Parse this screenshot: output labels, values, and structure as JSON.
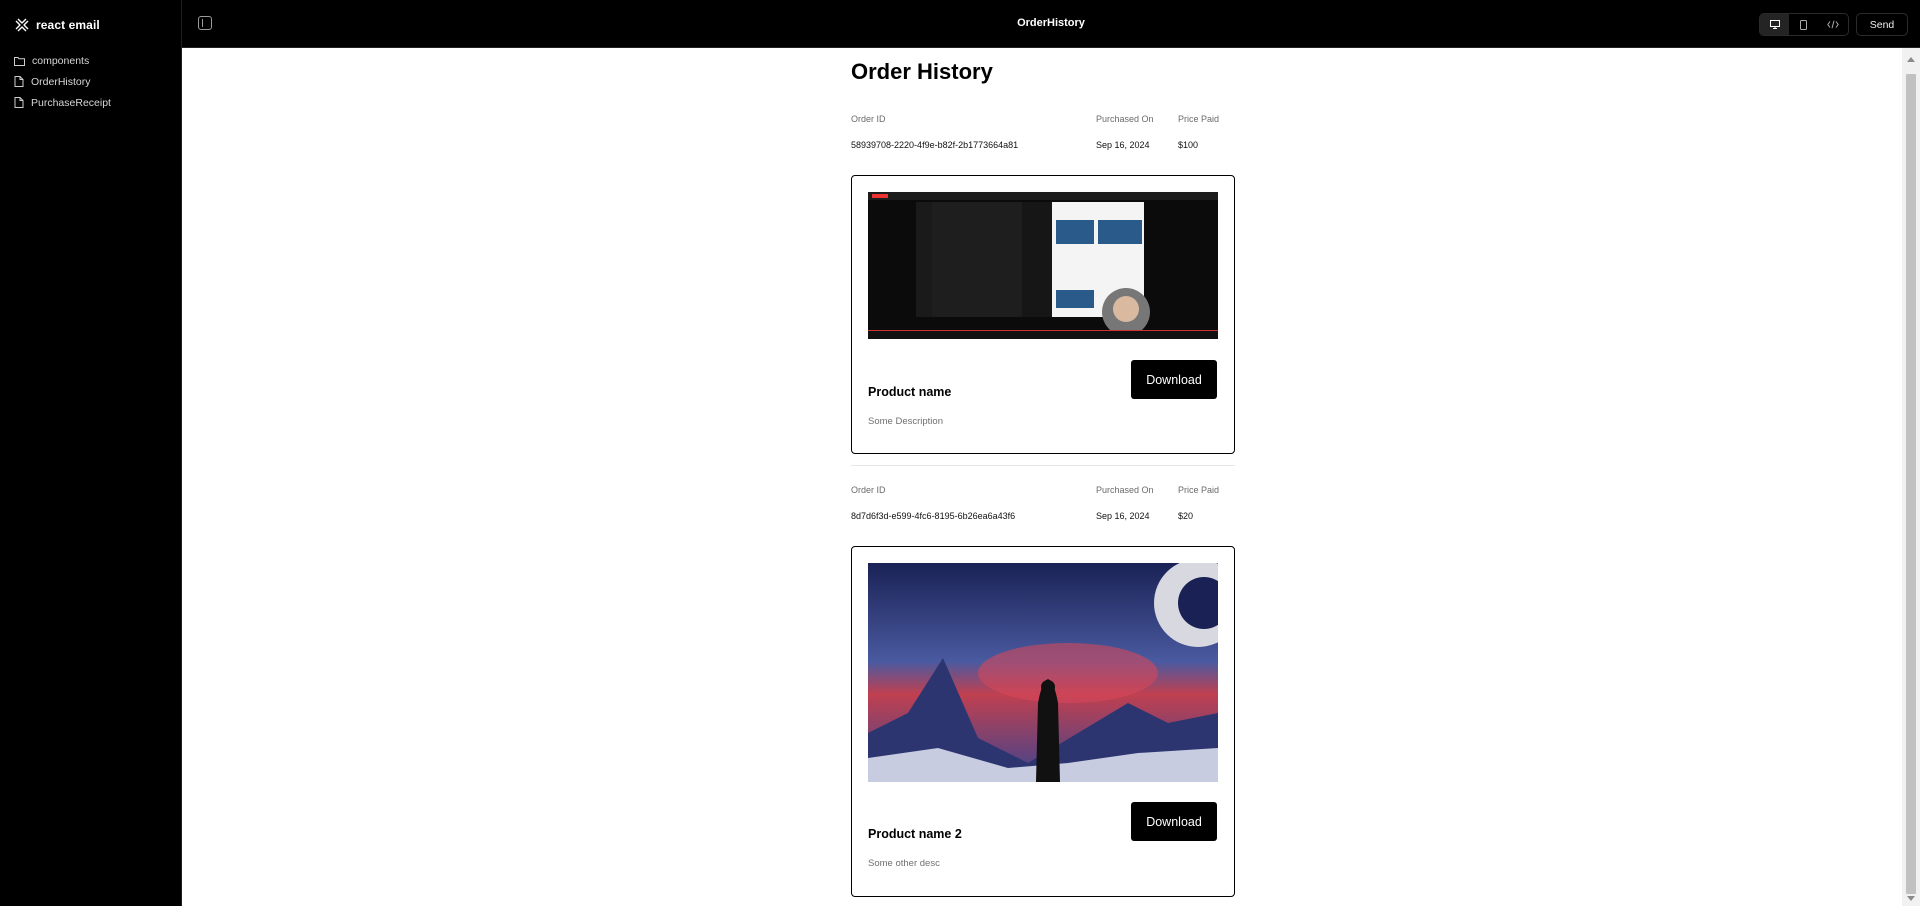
{
  "app": {
    "brand": "react email"
  },
  "sidebar": {
    "items": [
      {
        "label": "components",
        "icon": "folder-icon"
      },
      {
        "label": "OrderHistory",
        "icon": "file-icon"
      },
      {
        "label": "PurchaseReceipt",
        "icon": "file-icon"
      }
    ]
  },
  "topbar": {
    "title": "OrderHistory",
    "views": [
      "desktop",
      "mobile",
      "code"
    ],
    "active_view": "desktop",
    "send_label": "Send"
  },
  "email": {
    "title": "Order History",
    "columns": {
      "order_id": "Order ID",
      "purchased_on": "Purchased On",
      "price_paid": "Price Paid"
    },
    "orders": [
      {
        "order_id": "58939708-2220-4f9e-b82f-2b1773664a81",
        "purchased_on": "Sep 16, 2024",
        "price_paid": "$100",
        "product_name": "Product name",
        "product_desc": "Some Description",
        "download_label": "Download",
        "image": "video-screenshot"
      },
      {
        "order_id": "8d7d6f3d-e599-4fc6-8195-6b26ea6a43f6",
        "purchased_on": "Sep 16, 2024",
        "price_paid": "$20",
        "product_name": "Product name 2",
        "product_desc": "Some other desc",
        "download_label": "Download",
        "image": "mountain-landscape"
      }
    ]
  },
  "colors": {
    "sidebar_bg": "#000000",
    "button_bg": "#000000",
    "preview_bg": "#ffffff"
  }
}
